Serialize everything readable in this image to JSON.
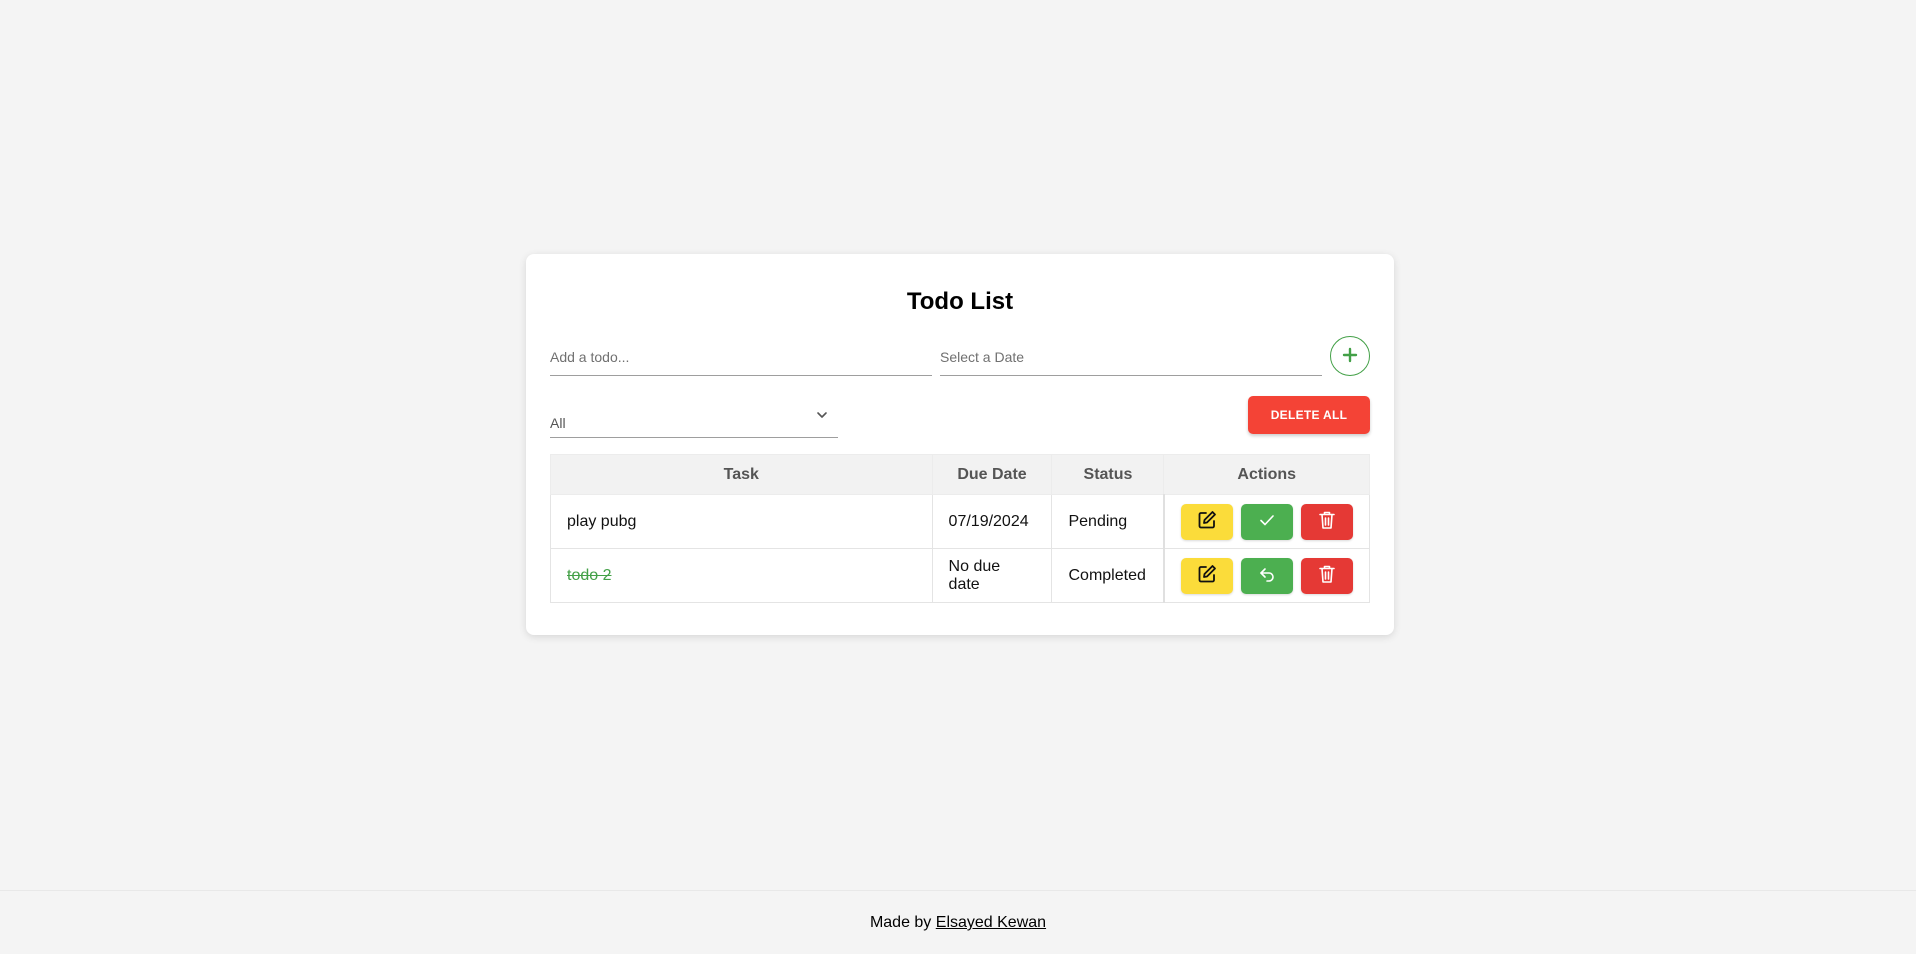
{
  "app": {
    "title": "Todo List"
  },
  "inputs": {
    "todo_placeholder": "Add a todo...",
    "todo_value": "",
    "date_placeholder": "Select a Date",
    "date_value": ""
  },
  "filter": {
    "selected": "All"
  },
  "buttons": {
    "delete_all": "DELETE ALL"
  },
  "table": {
    "headers": [
      "Task",
      "Due Date",
      "Status",
      "Actions"
    ],
    "rows": [
      {
        "task": "play pubg",
        "due_date": "07/19/2024",
        "status": "Pending",
        "completed": false
      },
      {
        "task": "todo 2",
        "due_date": "No due date",
        "status": "Completed",
        "completed": true
      }
    ]
  },
  "footer": {
    "prefix": "Made by",
    "author": "Elsayed Kewan"
  },
  "colors": {
    "accent_green": "#43a047",
    "danger_red": "#f44336",
    "edit_yellow": "#fbdc3a"
  },
  "icons": {
    "add": "plus-icon",
    "filter": "chevron-down-icon",
    "edit": "edit-icon",
    "complete": "check-icon",
    "undo": "undo-icon",
    "delete": "trash-icon"
  }
}
